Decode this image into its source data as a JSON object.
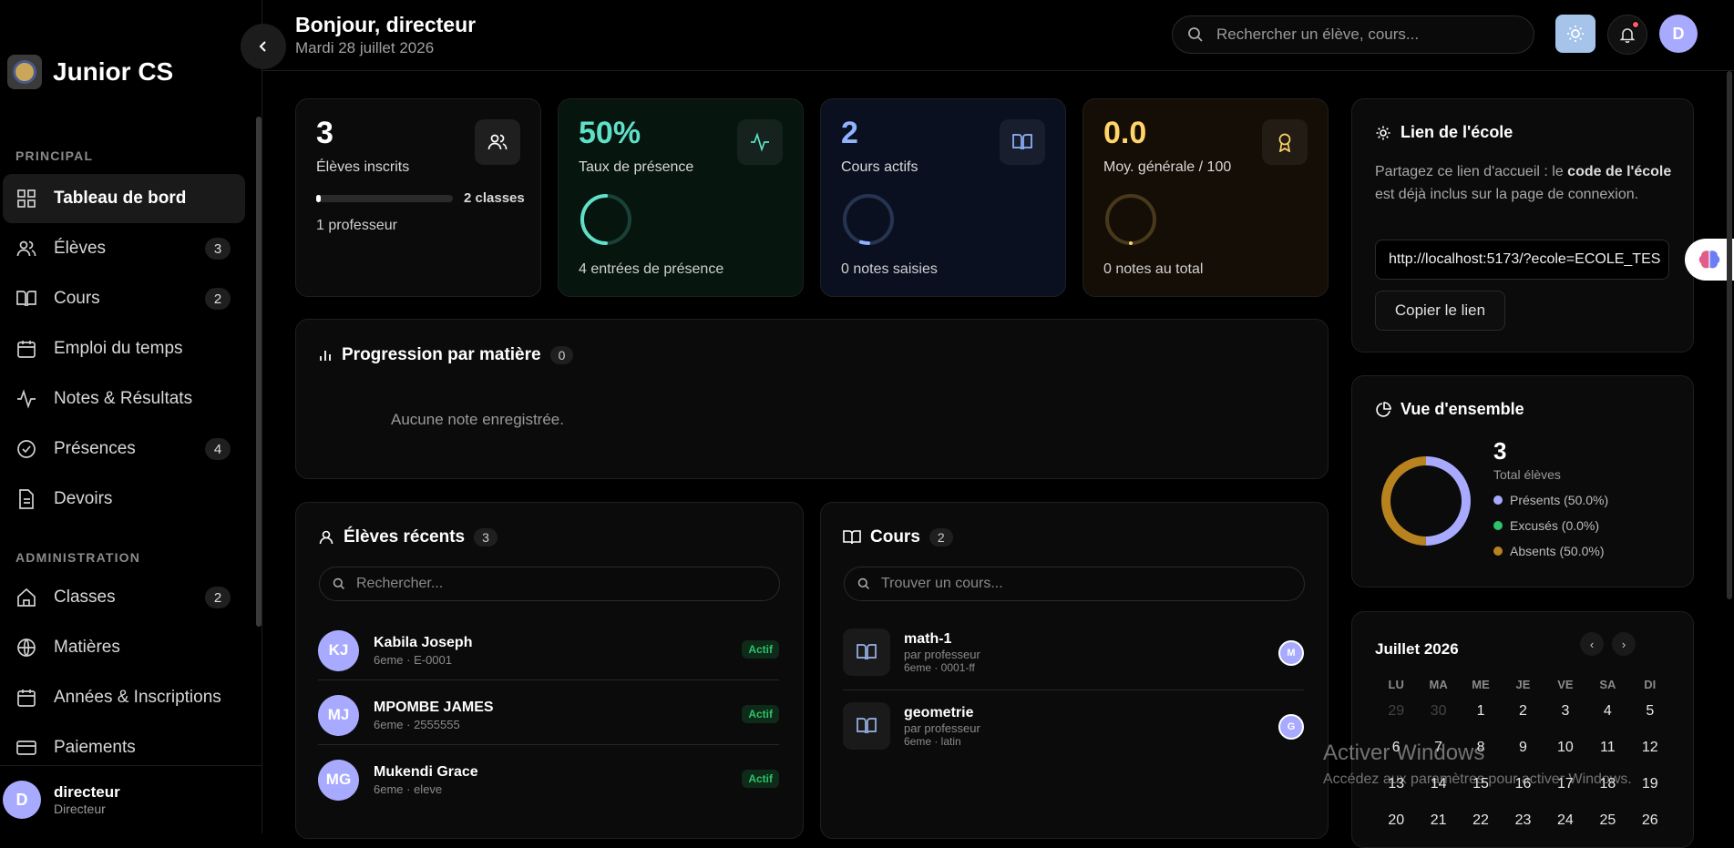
{
  "brand": {
    "name": "Junior CS"
  },
  "sidebar": {
    "section_principal": "PRINCIPAL",
    "section_admin": "ADMINISTRATION",
    "items": [
      {
        "label": "Tableau de bord",
        "icon": "dashboard-icon",
        "active": true
      },
      {
        "label": "Élèves",
        "icon": "users-icon",
        "count": "3"
      },
      {
        "label": "Cours",
        "icon": "book-icon",
        "count": "2"
      },
      {
        "label": "Emploi du temps",
        "icon": "calendar-icon"
      },
      {
        "label": "Notes & Résultats",
        "icon": "activity-icon"
      },
      {
        "label": "Présences",
        "icon": "check-circle-icon",
        "count": "4"
      },
      {
        "label": "Devoirs",
        "icon": "file-icon"
      },
      {
        "label": "Classes",
        "icon": "home-icon",
        "count": "2"
      },
      {
        "label": "Matières",
        "icon": "globe-icon"
      },
      {
        "label": "Années & Inscriptions",
        "icon": "calendar-icon"
      },
      {
        "label": "Paiements",
        "icon": "card-icon"
      }
    ],
    "user": {
      "initial": "D",
      "name": "directeur",
      "role": "Directeur"
    }
  },
  "header": {
    "greeting": "Bonjour, directeur",
    "date": "Mardi 28 juillet 2026",
    "search_placeholder": "Rechercher un élève, cours...",
    "avatar_initial": "D"
  },
  "stats": [
    {
      "value": "3",
      "label": "Élèves inscrits",
      "progress_label": "2 classes",
      "progress": 0.03,
      "footer": "1 professeur",
      "color": "#ffffff",
      "bg": "#0b0b0b",
      "icon": "users-icon"
    },
    {
      "value": "50%",
      "label": "Taux de présence",
      "ring": 0.5,
      "footer": "4 entrées de présence",
      "color": "#5fe0c8",
      "bg": "#07150f",
      "icon": "activity-icon"
    },
    {
      "value": "2",
      "label": "Cours actifs",
      "ring": 0.05,
      "footer": "0 notes saisies",
      "color": "#8fb4ff",
      "bg": "#0a1020",
      "icon": "book-icon"
    },
    {
      "value": "0.0",
      "label": "Moy. générale / 100",
      "ring": 0,
      "footer": "0 notes au total",
      "color": "#ffd56a",
      "bg": "#150e06",
      "icon": "award-icon"
    }
  ],
  "progression": {
    "title": "Progression par matière",
    "count": "0",
    "empty": "Aucune note enregistrée."
  },
  "recent_students": {
    "title": "Élèves récents",
    "count": "3",
    "search_placeholder": "Rechercher...",
    "rows": [
      {
        "initials": "KJ",
        "name": "Kabila Joseph",
        "sub": "6eme · E-0001",
        "status": "Actif"
      },
      {
        "initials": "MJ",
        "name": "MPOMBE JAMES",
        "sub": "6eme · 2555555",
        "status": "Actif"
      },
      {
        "initials": "MG",
        "name": "Mukendi Grace",
        "sub": "6eme · eleve",
        "status": "Actif"
      }
    ]
  },
  "courses": {
    "title": "Cours",
    "count": "2",
    "search_placeholder": "Trouver un cours...",
    "rows": [
      {
        "name": "math-1",
        "teacher": "par professeur",
        "sub": "6eme · 0001-ff",
        "initial": "M"
      },
      {
        "name": "geometrie",
        "teacher": "par professeur",
        "sub": "6eme · latin",
        "initial": "G"
      }
    ]
  },
  "school_link": {
    "title": "Lien de l'école",
    "desc_1": "Partagez ce lien d'accueil : le ",
    "desc_bold": "code de l'école",
    "desc_2": " est déjà inclus sur la page de connexion.",
    "url": "http://localhost:5173/?ecole=ECOLE_TES",
    "copy_label": "Copier le lien"
  },
  "overview": {
    "title": "Vue d'ensemble",
    "total": "3",
    "total_label": "Total élèves",
    "legend": [
      {
        "label": "Présents (50.0%)",
        "color": "#a8aaff",
        "value": 50
      },
      {
        "label": "Excusés (0.0%)",
        "color": "#2ec26b",
        "value": 0
      },
      {
        "label": "Absents (50.0%)",
        "color": "#b8821e",
        "value": 50
      }
    ]
  },
  "calendar": {
    "month": "Juillet 2026",
    "days": [
      "LU",
      "MA",
      "ME",
      "JE",
      "VE",
      "SA",
      "DI"
    ],
    "weeks": [
      [
        "29",
        "30",
        "1",
        "2",
        "3",
        "4",
        "5"
      ],
      [
        "6",
        "7",
        "8",
        "9",
        "10",
        "11",
        "12"
      ],
      [
        "13",
        "14",
        "15",
        "16",
        "17",
        "18",
        "19"
      ],
      [
        "20",
        "21",
        "22",
        "23",
        "24",
        "25",
        "26"
      ]
    ],
    "muted_first": 2
  },
  "watermark": {
    "line1": "Activer Windows",
    "line2": "Accédez aux paramètres pour activer Windows."
  }
}
